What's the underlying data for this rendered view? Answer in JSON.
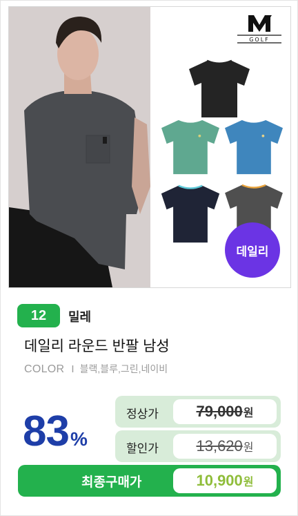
{
  "hero": {
    "logo_text": "GOLF",
    "badge_label": "데일리",
    "badge_color": "#6b34e4",
    "tee_colors": [
      "#242424",
      "#5fa890",
      "#3f86bd",
      "#1f2436",
      "#4f4f4f"
    ],
    "tee_collar_colors": [
      "#242424",
      "#5fa890",
      "#3f86bd",
      "#5ec9d8",
      "#e8a23a"
    ]
  },
  "product": {
    "rank": "12",
    "brand": "밀레",
    "title": "데일리 라운드 반팔 남성",
    "color_label": "COLOR",
    "color_separator": "I",
    "color_values": "블랙,블루,그린,네이비"
  },
  "pricing": {
    "discount": "83",
    "discount_unit": "%",
    "regular_label": "정상가",
    "regular_price": "79,000",
    "sale_label": "할인가",
    "sale_price": "13,620",
    "final_label": "최종구매가",
    "final_price": "10,900",
    "currency": "원"
  },
  "colors": {
    "accent_green": "#23b14d",
    "discount_blue": "#1e3ea8",
    "price_panel": "#d8ecd9"
  }
}
